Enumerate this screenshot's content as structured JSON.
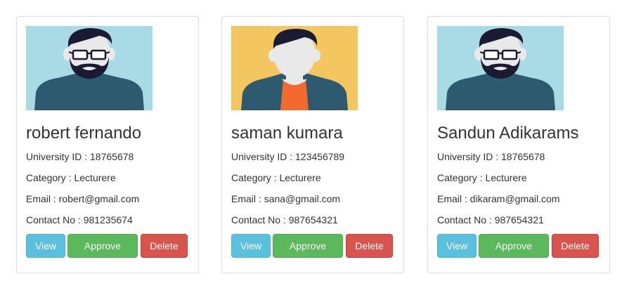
{
  "cards": [
    {
      "name": "robert fernando",
      "university_id": "University ID : 18765678",
      "category": "Category : Lecturere",
      "email": "Email : robert@gmail.com",
      "contact": "Contact No : 981235674",
      "avatar": "bearded-man-avatar",
      "avatar_bg": "#a8dbe6",
      "buttons": {
        "view": "View",
        "approve": "Approve",
        "delete": "Delete"
      }
    },
    {
      "name": "saman kumara",
      "university_id": "University ID : 123456789",
      "category": "Category : Lecturere",
      "email": "Email : sana@gmail.com",
      "contact": "Contact No : 987654321",
      "avatar": "man-avatar",
      "avatar_bg": "#f4c660",
      "buttons": {
        "view": "View",
        "approve": "Approve",
        "delete": "Delete"
      }
    },
    {
      "name": "Sandun Adikarams",
      "university_id": "University ID : 18765678",
      "category": "Category : Lecturere",
      "email": "Email : dikaram@gmail.com",
      "contact": "Contact No : 987654321",
      "avatar": "bearded-man-avatar",
      "avatar_bg": "#a8dbe6",
      "buttons": {
        "view": "View",
        "approve": "Approve",
        "delete": "Delete"
      }
    }
  ],
  "colors": {
    "view": "#5bc0de",
    "approve": "#5cb85c",
    "delete": "#d9534f",
    "card_border": "#dddddd"
  }
}
